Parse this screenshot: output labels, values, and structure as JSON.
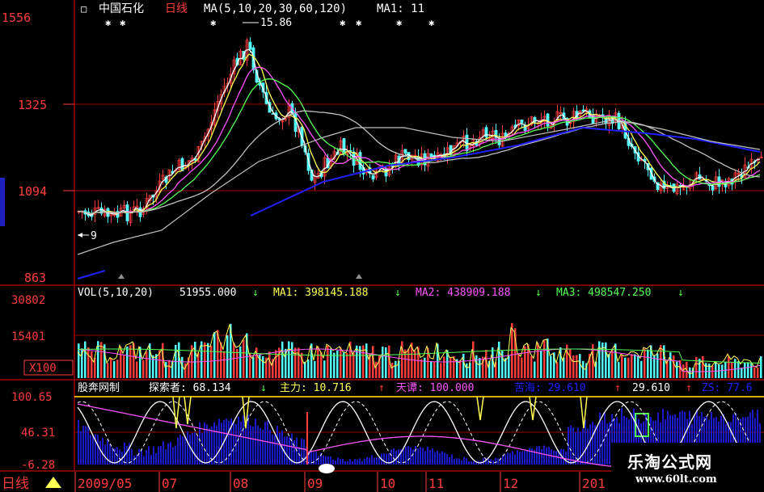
{
  "colors": {
    "background": "#000000",
    "grid_red": "#a00000",
    "axis_red": "#ff3c3c",
    "up_candle": "#ff3c3c",
    "down_candle": "#54ffff",
    "white": "#ffffff",
    "yellow": "#ffff54",
    "magenta": "#ff54ff",
    "green": "#54ff54",
    "blue": "#2020ff",
    "grey": "#c0c0c0",
    "gold": "#d4b000"
  },
  "main_panel": {
    "stock_name": "中国石化",
    "period": "日线",
    "ma_params": "MA(5,10,20,30,60,120)",
    "ma1": "MA1: 11",
    "price_axis": [
      "1556",
      "1325",
      "1094",
      "863"
    ],
    "peak_label": "15.86",
    "low_label": "9",
    "marker_glyph": "✱"
  },
  "volume_panel": {
    "header": "VOL(5,10,20)",
    "vol_value": "51955.000",
    "ma1": "MA1: 398145.188",
    "ma2": "MA2: 438909.188",
    "ma3": "MA3: 498547.250",
    "arrow": "↓",
    "axis": [
      "30802",
      "15401",
      "X100"
    ]
  },
  "indicator_panel": {
    "name": "股奔网制",
    "explorer": "探索者: 68.134",
    "main_force": "主力: 10.716",
    "tianluo": "天谭: 100.000",
    "kuhai": "苦海: 29.610",
    "kuhai_value": "29.610",
    "zs": "ZS: 77.6",
    "down_arrow": "↓",
    "up_arrow": "↑",
    "axis": [
      "100.65",
      "46.31",
      "-6.28"
    ]
  },
  "time_axis": {
    "period_button": "日线",
    "labels": [
      "2009/05",
      "07",
      "08",
      "09",
      "10",
      "11",
      "12",
      "201"
    ]
  },
  "watermark": {
    "title": "乐淘公式网",
    "url": "www.60lt.com"
  }
}
